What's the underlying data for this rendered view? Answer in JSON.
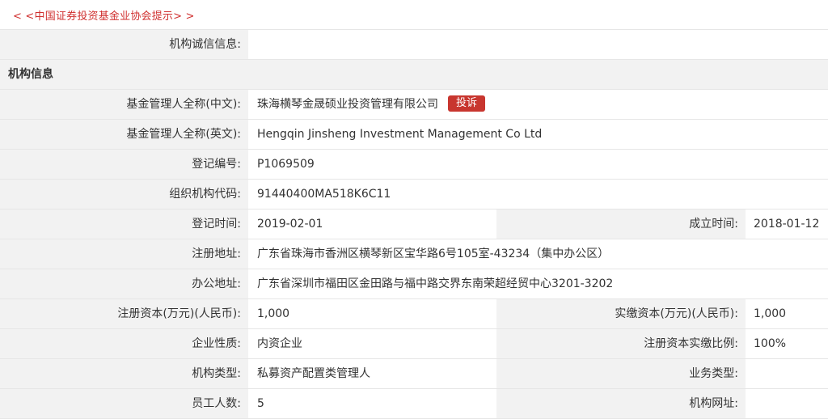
{
  "notice": "< <中国证券投资基金业协会提示> >",
  "credit_label": "机构诚信信息:",
  "credit_value": "",
  "section_title": "机构信息",
  "complaint_button": "投诉",
  "rows": [
    {
      "label": "基金管理人全称(中文):",
      "value": "珠海横琴金晟硕业投资管理有限公司"
    },
    {
      "label": "基金管理人全称(英文):",
      "value": "Hengqin Jinsheng Investment Management Co Ltd"
    },
    {
      "label": "登记编号:",
      "value": "P1069509"
    },
    {
      "label": "组织机构代码:",
      "value": "91440400MA518K6C11"
    },
    {
      "label": "登记时间:",
      "value": "2019-02-01",
      "label2": "成立时间:",
      "value2": "2018-01-12"
    },
    {
      "label": "注册地址:",
      "value": "广东省珠海市香洲区横琴新区宝华路6号105室-43234（集中办公区）"
    },
    {
      "label": "办公地址:",
      "value": "广东省深圳市福田区金田路与福中路交界东南荣超经贸中心3201-3202"
    },
    {
      "label": "注册资本(万元)(人民币):",
      "value": "1,000",
      "label2": "实缴资本(万元)(人民币):",
      "value2": "1,000"
    },
    {
      "label": "企业性质:",
      "value": "内资企业",
      "label2": "注册资本实缴比例:",
      "value2": "100%"
    },
    {
      "label": "机构类型:",
      "value": "私募资产配置类管理人",
      "label2": "业务类型:",
      "value2": ""
    },
    {
      "label": "员工人数:",
      "value": "5",
      "label2": "机构网址:",
      "value2": ""
    }
  ]
}
